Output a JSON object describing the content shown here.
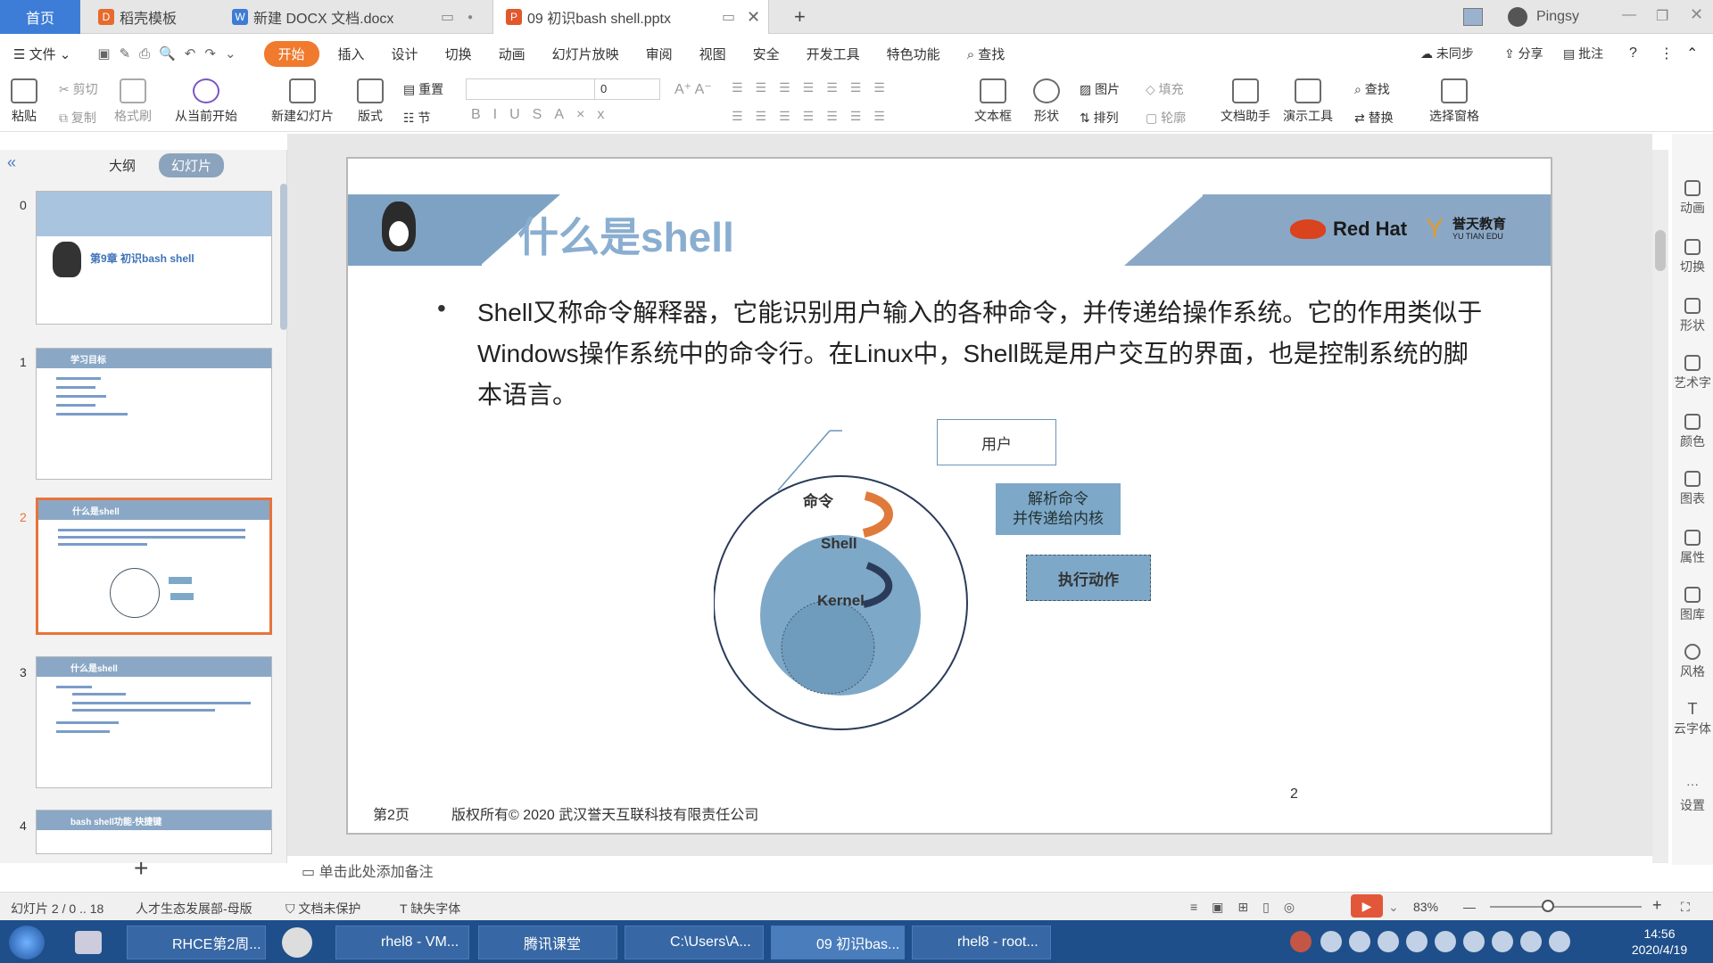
{
  "tabs": {
    "home": "首页",
    "t1": "稻壳模板",
    "t2": "新建 DOCX 文档.docx",
    "t3": "09 初识bash shell.pptx",
    "add": "+",
    "user": "Pingsy"
  },
  "menubar": {
    "file": "文件",
    "items": [
      "开始",
      "插入",
      "设计",
      "切换",
      "动画",
      "幻灯片放映",
      "审阅",
      "视图",
      "安全",
      "开发工具",
      "特色功能"
    ],
    "search": "查找",
    "sync": "未同步",
    "share": "分享",
    "comment": "批注"
  },
  "ribbon": {
    "paste": "粘贴",
    "cut": "剪切",
    "copy": "复制",
    "format_painter": "格式刷",
    "from_current": "从当前开始",
    "new_slide": "新建幻灯片",
    "layout": "版式",
    "reset": "重置",
    "section": "节",
    "font_size": "0",
    "textbox": "文本框",
    "shape": "形状",
    "picture": "图片",
    "fill": "填充",
    "arrange": "排列",
    "outline": "轮廓",
    "doc_assistant": "文档助手",
    "presenter": "演示工具",
    "find": "查找",
    "replace": "替换",
    "select_pane": "选择窗格"
  },
  "pane": {
    "outline": "大纲",
    "slides": "幻灯片",
    "thumbs": [
      {
        "num": "0",
        "title": "第9章 初识bash shell"
      },
      {
        "num": "1",
        "title": "学习目标"
      },
      {
        "num": "2",
        "title": "什么是shell"
      },
      {
        "num": "3",
        "title": "什么是shell"
      },
      {
        "num": "4",
        "title": "bash shell功能-快捷键"
      }
    ],
    "add": "+"
  },
  "slide": {
    "title": "什么是shell",
    "logo_text": "Red Hat",
    "logo_cn": "誉天教育",
    "logo_en": "YU TIAN EDU",
    "bullet": "•",
    "body": "Shell又称命令解释器，它能识别用户输入的各种命令，并传递给操作系统。它的作用类似于Windows操作系统中的命令行。在Linux中，Shell既是用户交互的界面，也是控制系统的脚本语言。",
    "diagram": {
      "user": "用户",
      "command": "命令",
      "shell": "Shell",
      "kernel": "Kernel",
      "parse": "解析命令\n并传递给内核",
      "execute": "执行动作"
    },
    "footer_page": "第2页",
    "footer_copy": "版权所有© 2020 武汉誉天互联科技有限责任公司",
    "page_num": "2"
  },
  "rightbar": [
    "动画",
    "切换",
    "形状",
    "艺术字",
    "颜色",
    "图表",
    "属性",
    "图库",
    "风格",
    "云字体",
    "设置"
  ],
  "notes": "单击此处添加备注",
  "status": {
    "slide": "幻灯片 2 / 0 .. 18",
    "template": "人才生态发展部-母版",
    "protect": "文档未保护",
    "missing_font": "缺失字体",
    "zoom": "83%"
  },
  "taskbar": {
    "items": [
      "RHCE第2周...",
      "rhel8 - VM...",
      "腾讯课堂",
      "C:\\Users\\A...",
      "09 初识bas...",
      "rhel8 - root..."
    ],
    "time": "14:56",
    "date": "2020/4/19"
  },
  "colors": {
    "accent": "#f07a2d",
    "slide_blue": "#8aa8c6",
    "circle_blue": "#7ea8c8",
    "box_blue": "#7ea8c8"
  }
}
